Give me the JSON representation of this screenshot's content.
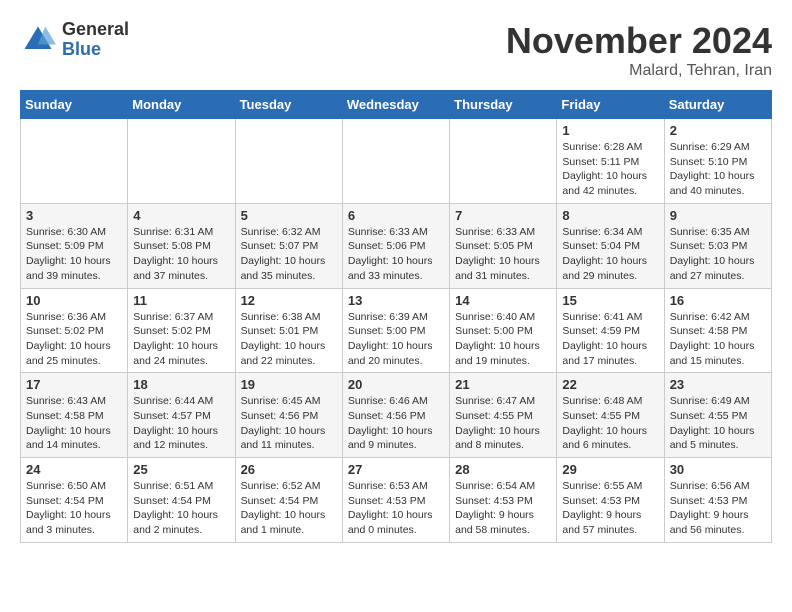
{
  "logo": {
    "general": "General",
    "blue": "Blue"
  },
  "title": "November 2024",
  "location": "Malard, Tehran, Iran",
  "weekdays": [
    "Sunday",
    "Monday",
    "Tuesday",
    "Wednesday",
    "Thursday",
    "Friday",
    "Saturday"
  ],
  "weeks": [
    [
      {
        "day": "",
        "info": ""
      },
      {
        "day": "",
        "info": ""
      },
      {
        "day": "",
        "info": ""
      },
      {
        "day": "",
        "info": ""
      },
      {
        "day": "",
        "info": ""
      },
      {
        "day": "1",
        "info": "Sunrise: 6:28 AM\nSunset: 5:11 PM\nDaylight: 10 hours and 42 minutes."
      },
      {
        "day": "2",
        "info": "Sunrise: 6:29 AM\nSunset: 5:10 PM\nDaylight: 10 hours and 40 minutes."
      }
    ],
    [
      {
        "day": "3",
        "info": "Sunrise: 6:30 AM\nSunset: 5:09 PM\nDaylight: 10 hours and 39 minutes."
      },
      {
        "day": "4",
        "info": "Sunrise: 6:31 AM\nSunset: 5:08 PM\nDaylight: 10 hours and 37 minutes."
      },
      {
        "day": "5",
        "info": "Sunrise: 6:32 AM\nSunset: 5:07 PM\nDaylight: 10 hours and 35 minutes."
      },
      {
        "day": "6",
        "info": "Sunrise: 6:33 AM\nSunset: 5:06 PM\nDaylight: 10 hours and 33 minutes."
      },
      {
        "day": "7",
        "info": "Sunrise: 6:33 AM\nSunset: 5:05 PM\nDaylight: 10 hours and 31 minutes."
      },
      {
        "day": "8",
        "info": "Sunrise: 6:34 AM\nSunset: 5:04 PM\nDaylight: 10 hours and 29 minutes."
      },
      {
        "day": "9",
        "info": "Sunrise: 6:35 AM\nSunset: 5:03 PM\nDaylight: 10 hours and 27 minutes."
      }
    ],
    [
      {
        "day": "10",
        "info": "Sunrise: 6:36 AM\nSunset: 5:02 PM\nDaylight: 10 hours and 25 minutes."
      },
      {
        "day": "11",
        "info": "Sunrise: 6:37 AM\nSunset: 5:02 PM\nDaylight: 10 hours and 24 minutes."
      },
      {
        "day": "12",
        "info": "Sunrise: 6:38 AM\nSunset: 5:01 PM\nDaylight: 10 hours and 22 minutes."
      },
      {
        "day": "13",
        "info": "Sunrise: 6:39 AM\nSunset: 5:00 PM\nDaylight: 10 hours and 20 minutes."
      },
      {
        "day": "14",
        "info": "Sunrise: 6:40 AM\nSunset: 5:00 PM\nDaylight: 10 hours and 19 minutes."
      },
      {
        "day": "15",
        "info": "Sunrise: 6:41 AM\nSunset: 4:59 PM\nDaylight: 10 hours and 17 minutes."
      },
      {
        "day": "16",
        "info": "Sunrise: 6:42 AM\nSunset: 4:58 PM\nDaylight: 10 hours and 15 minutes."
      }
    ],
    [
      {
        "day": "17",
        "info": "Sunrise: 6:43 AM\nSunset: 4:58 PM\nDaylight: 10 hours and 14 minutes."
      },
      {
        "day": "18",
        "info": "Sunrise: 6:44 AM\nSunset: 4:57 PM\nDaylight: 10 hours and 12 minutes."
      },
      {
        "day": "19",
        "info": "Sunrise: 6:45 AM\nSunset: 4:56 PM\nDaylight: 10 hours and 11 minutes."
      },
      {
        "day": "20",
        "info": "Sunrise: 6:46 AM\nSunset: 4:56 PM\nDaylight: 10 hours and 9 minutes."
      },
      {
        "day": "21",
        "info": "Sunrise: 6:47 AM\nSunset: 4:55 PM\nDaylight: 10 hours and 8 minutes."
      },
      {
        "day": "22",
        "info": "Sunrise: 6:48 AM\nSunset: 4:55 PM\nDaylight: 10 hours and 6 minutes."
      },
      {
        "day": "23",
        "info": "Sunrise: 6:49 AM\nSunset: 4:55 PM\nDaylight: 10 hours and 5 minutes."
      }
    ],
    [
      {
        "day": "24",
        "info": "Sunrise: 6:50 AM\nSunset: 4:54 PM\nDaylight: 10 hours and 3 minutes."
      },
      {
        "day": "25",
        "info": "Sunrise: 6:51 AM\nSunset: 4:54 PM\nDaylight: 10 hours and 2 minutes."
      },
      {
        "day": "26",
        "info": "Sunrise: 6:52 AM\nSunset: 4:54 PM\nDaylight: 10 hours and 1 minute."
      },
      {
        "day": "27",
        "info": "Sunrise: 6:53 AM\nSunset: 4:53 PM\nDaylight: 10 hours and 0 minutes."
      },
      {
        "day": "28",
        "info": "Sunrise: 6:54 AM\nSunset: 4:53 PM\nDaylight: 9 hours and 58 minutes."
      },
      {
        "day": "29",
        "info": "Sunrise: 6:55 AM\nSunset: 4:53 PM\nDaylight: 9 hours and 57 minutes."
      },
      {
        "day": "30",
        "info": "Sunrise: 6:56 AM\nSunset: 4:53 PM\nDaylight: 9 hours and 56 minutes."
      }
    ]
  ]
}
